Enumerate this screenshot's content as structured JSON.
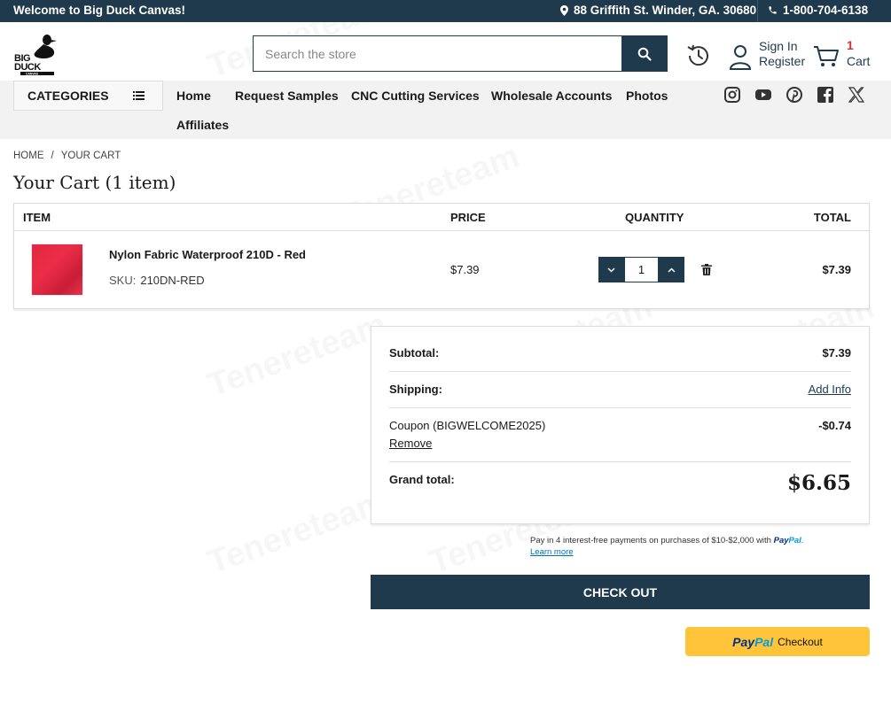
{
  "topbar": {
    "welcome": "Welcome to Big Duck Canvas!",
    "address": "88 Griffith St. Winder, GA. 30680",
    "phone": "1-800-704-6138"
  },
  "header": {
    "logo_text": "BIG DUCK CANVAS",
    "search_placeholder": "Search the store",
    "sign_in": "Sign In",
    "register": "Register",
    "cart_count": "1",
    "cart_label": "Cart"
  },
  "nav": {
    "categories_label": "CATEGORIES",
    "items": [
      "Home",
      "Request Samples",
      "CNC Cutting Services",
      "Wholesale Accounts",
      "Photos",
      "Affiliates"
    ],
    "social": [
      "instagram-icon",
      "youtube-icon",
      "pinterest-icon",
      "facebook-icon",
      "x-icon"
    ]
  },
  "breadcrumb": {
    "home": "HOME",
    "separator": "/",
    "current": "YOUR CART"
  },
  "page_title": "Your Cart (1 item)",
  "table": {
    "headers": [
      "ITEM",
      "PRICE",
      "QUANTITY",
      "TOTAL"
    ],
    "rows": [
      {
        "name": "Nylon Fabric Waterproof 210D - Red",
        "sku_label": "SKU:",
        "sku": "210DN-RED",
        "price": "$7.39",
        "quantity": "1",
        "total": "$7.39"
      }
    ]
  },
  "summary": {
    "subtotal_label": "Subtotal:",
    "subtotal": "$7.39",
    "shipping_label": "Shipping:",
    "shipping_action": "Add Info",
    "coupon_label": "Coupon (BIGWELCOME2025)",
    "coupon_value": "-$0.74",
    "coupon_remove": "Remove",
    "grand_label": "Grand total:",
    "grand_total": "$6.65"
  },
  "paypal_message": {
    "text": "Pay in 4 interest-free payments on purchases of $10-$2,000 with",
    "brand_a": "Pay",
    "brand_b": "Pal",
    "period": ".",
    "learn_more": "Learn more"
  },
  "checkout_label": "CHECK OUT",
  "paypal_button": {
    "brand_a": "Pay",
    "brand_b": "Pal",
    "label": "Checkout"
  },
  "watermark": "Tenereteam",
  "colors": {
    "navy": "#1e3a4c",
    "cart_count": "#d32f2f",
    "paypal_yellow": "#ffc439",
    "product_red": "#e02840"
  }
}
